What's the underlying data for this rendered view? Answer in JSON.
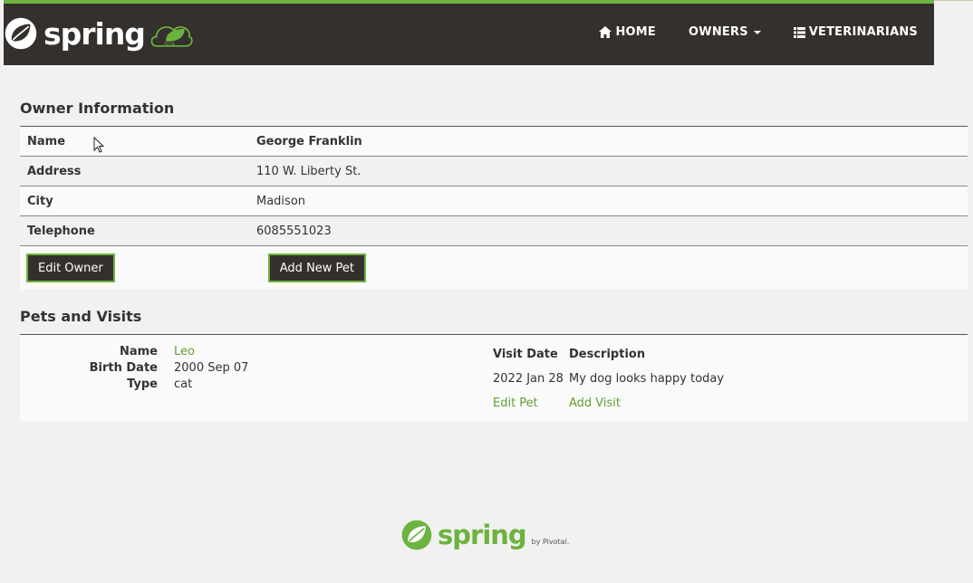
{
  "brand": {
    "text": "spring",
    "cloud_badge": "019",
    "accent": "#6db33f",
    "nav_bg": "#34302d"
  },
  "nav": {
    "home": {
      "label": "HOME",
      "icon": "home-icon"
    },
    "owners": {
      "label": "OWNERS",
      "icon": "caret-down-icon"
    },
    "vets": {
      "label": "VETERINARIANS",
      "icon": "list-icon"
    }
  },
  "owner": {
    "title": "Owner Information",
    "rows": [
      {
        "label": "Name",
        "value": "George Franklin"
      },
      {
        "label": "Address",
        "value": "110 W. Liberty St."
      },
      {
        "label": "City",
        "value": "Madison"
      },
      {
        "label": "Telephone",
        "value": "6085551023"
      }
    ],
    "edit_label": "Edit Owner",
    "add_pet_label": "Add New Pet"
  },
  "pets": {
    "title": "Pets and Visits",
    "pet": {
      "name_label": "Name",
      "name": "Leo",
      "birth_label": "Birth Date",
      "birth": "2000 Sep 07",
      "type_label": "Type",
      "type": "cat"
    },
    "visits": {
      "date_header": "Visit Date",
      "desc_header": "Description",
      "rows": [
        {
          "date": "2022 Jan 28",
          "description": "My dog looks happy today"
        }
      ],
      "edit_pet_label": "Edit Pet",
      "add_visit_label": "Add Visit"
    }
  },
  "footer": {
    "text": "spring",
    "by": "by Pivotal."
  }
}
